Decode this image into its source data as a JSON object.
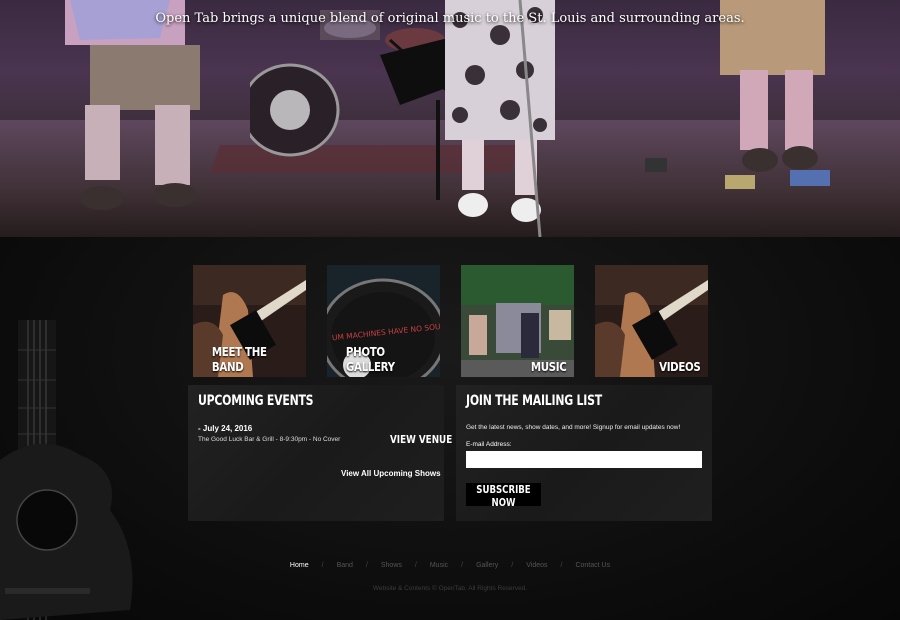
{
  "hero": {
    "tagline": "Open Tab brings a unique blend of original music to the St. Louis and surrounding areas.",
    "drum_text": ""
  },
  "tiles": [
    {
      "label": "MEET THE BAND"
    },
    {
      "label": "PHOTO GALLERY",
      "drum_text": "UM MACHINES HAVE NO SOU"
    },
    {
      "label": "MUSIC"
    },
    {
      "label": "VIDEOS"
    }
  ],
  "events": {
    "title": "UPCOMING EVENTS",
    "date": "- July 24, 2016",
    "description": "The Good Luck Bar & Grill - 8-9:30pm - No Cover",
    "venue_link": "VIEW VENUE",
    "all_link": "View All Upcoming Shows"
  },
  "mailing": {
    "title": "JOIN THE MAILING LIST",
    "description": "Get the latest news, show dates, and more! Signup for email updates now!",
    "email_label": "E-mail Address:",
    "email_value": "",
    "button": "SUBSCRIBE NOW"
  },
  "footer": {
    "nav": [
      "Home",
      "Band",
      "Shows",
      "Music",
      "Gallery",
      "Videos",
      "Contact Us"
    ],
    "separator": "/",
    "copyright": "Website & Contents © OpenTab. All Rights Reserved."
  },
  "colors": {
    "background": "#0b0b0b",
    "panel": "#1c1c1c",
    "text": "#ffffff",
    "nav_inactive": "#555555"
  }
}
